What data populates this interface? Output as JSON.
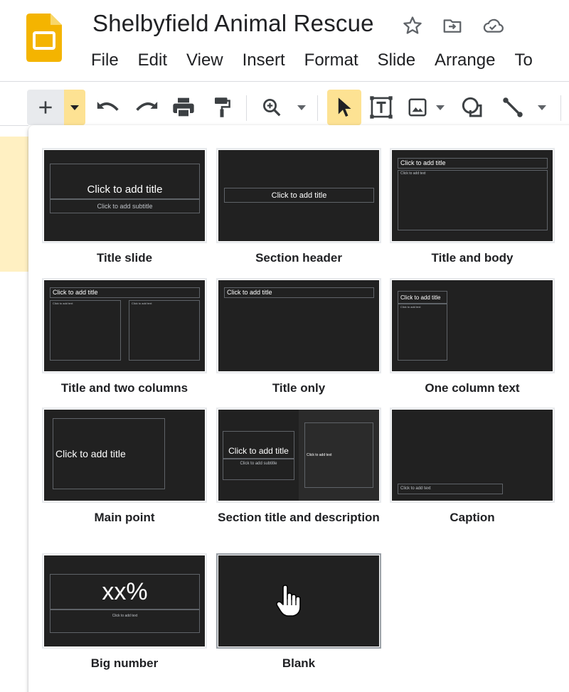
{
  "header": {
    "title": "Shelbyfield Animal Rescue",
    "icons": {
      "star": "star-icon",
      "move": "move-to-folder-icon",
      "cloud": "cloud-saved-icon"
    },
    "menu": [
      "File",
      "Edit",
      "View",
      "Insert",
      "Format",
      "Slide",
      "Arrange",
      "To"
    ]
  },
  "colors": {
    "brand_yellow": "#f4b400",
    "active_yellow": "#fde293",
    "slide_bg": "#212121"
  },
  "toolbar": {
    "icons": [
      "plus-icon",
      "dropdown-arrow-icon",
      "undo-icon",
      "redo-icon",
      "print-icon",
      "paint-format-icon",
      "zoom-icon",
      "select-cursor-icon",
      "text-box-icon",
      "image-icon",
      "shape-icon",
      "line-icon"
    ]
  },
  "layouts": [
    {
      "label": "Title slide",
      "title_ph": "Click to add title",
      "subtitle_ph": "Click to add subtitle"
    },
    {
      "label": "Section header",
      "title_ph": "Click to add title"
    },
    {
      "label": "Title and body",
      "title_ph": "Click to add title",
      "body_ph": "Click to add text"
    },
    {
      "label": "Title and two columns",
      "title_ph": "Click to add title",
      "col1_ph": "Click to add text",
      "col2_ph": "Click to add text"
    },
    {
      "label": "Title only",
      "title_ph": "Click to add title"
    },
    {
      "label": "One column text",
      "title_ph": "Click to add title",
      "body_ph": "Click to add text"
    },
    {
      "label": "Main point",
      "title_ph": "Click to add title"
    },
    {
      "label": "Section title and description",
      "title_ph": "Click to add title",
      "subtitle_ph": "Click to add subtitle",
      "body_ph": "Click to add text"
    },
    {
      "label": "Caption",
      "body_ph": "Click to add text"
    },
    {
      "label": "Big number",
      "number_ph": "xx%",
      "body_ph": "Click to add text"
    },
    {
      "label": "Blank"
    }
  ]
}
